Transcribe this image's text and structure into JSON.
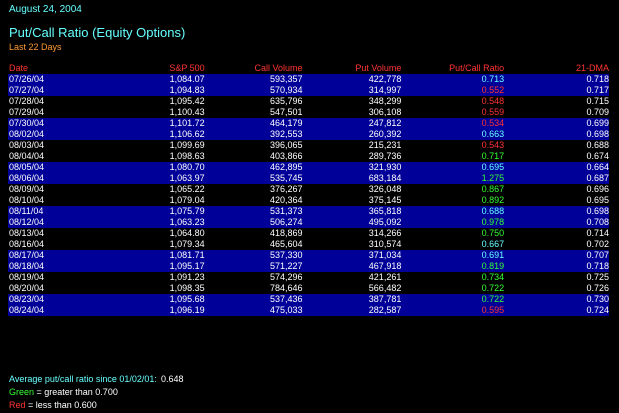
{
  "header": {
    "date": "August 24, 2004",
    "title": "Put/Call Ratio (Equity Options)",
    "subtitle": "Last 22 Days"
  },
  "colors": {
    "background": "#000000",
    "band": "#000099",
    "cyan": "#66ffff",
    "green": "#33ff33",
    "red": "#ff3333",
    "orange": "#ff9933"
  },
  "table": {
    "columns": [
      "Date",
      "S&P 500",
      "Call Volume",
      "Put Volume",
      "Put/Call Ratio",
      "21-DMA"
    ],
    "rows": [
      {
        "date": "07/26/04",
        "sp": "1,084.07",
        "call": "593,357",
        "put": "422,778",
        "ratio": "0.713",
        "dma": "0.718",
        "ratio_color": "cyan",
        "band": true
      },
      {
        "date": "07/27/04",
        "sp": "1,094.83",
        "call": "570,934",
        "put": "314,997",
        "ratio": "0.552",
        "dma": "0.717",
        "ratio_color": "red",
        "band": true
      },
      {
        "date": "07/28/04",
        "sp": "1,095.42",
        "call": "635,796",
        "put": "348,299",
        "ratio": "0.548",
        "dma": "0.715",
        "ratio_color": "red",
        "band": false
      },
      {
        "date": "07/29/04",
        "sp": "1,100.43",
        "call": "547,501",
        "put": "306,108",
        "ratio": "0.559",
        "dma": "0.709",
        "ratio_color": "red",
        "band": false
      },
      {
        "date": "07/30/04",
        "sp": "1,101.72",
        "call": "464,179",
        "put": "247,812",
        "ratio": "0.534",
        "dma": "0.699",
        "ratio_color": "red",
        "band": true
      },
      {
        "date": "08/02/04",
        "sp": "1,106.62",
        "call": "392,553",
        "put": "260,392",
        "ratio": "0.663",
        "dma": "0.698",
        "ratio_color": "cyan",
        "band": true
      },
      {
        "date": "08/03/04",
        "sp": "1,099.69",
        "call": "396,065",
        "put": "215,231",
        "ratio": "0.543",
        "dma": "0.688",
        "ratio_color": "red",
        "band": false
      },
      {
        "date": "08/04/04",
        "sp": "1,098.63",
        "call": "403,866",
        "put": "289,736",
        "ratio": "0.717",
        "dma": "0.674",
        "ratio_color": "green",
        "band": false
      },
      {
        "date": "08/05/04",
        "sp": "1,080.70",
        "call": "462,895",
        "put": "321,930",
        "ratio": "0.695",
        "dma": "0.664",
        "ratio_color": "cyan",
        "band": true
      },
      {
        "date": "08/06/04",
        "sp": "1,063.97",
        "call": "535,745",
        "put": "683,184",
        "ratio": "1.275",
        "dma": "0.687",
        "ratio_color": "green",
        "band": true
      },
      {
        "date": "08/09/04",
        "sp": "1,065.22",
        "call": "376,267",
        "put": "326,048",
        "ratio": "0.867",
        "dma": "0.696",
        "ratio_color": "green",
        "band": false
      },
      {
        "date": "08/10/04",
        "sp": "1,079.04",
        "call": "420,364",
        "put": "375,145",
        "ratio": "0.892",
        "dma": "0.695",
        "ratio_color": "green",
        "band": false
      },
      {
        "date": "08/11/04",
        "sp": "1,075.79",
        "call": "531,373",
        "put": "365,818",
        "ratio": "0.688",
        "dma": "0.698",
        "ratio_color": "cyan",
        "band": true
      },
      {
        "date": "08/12/04",
        "sp": "1,063.23",
        "call": "506,274",
        "put": "495,092",
        "ratio": "0.978",
        "dma": "0.708",
        "ratio_color": "green",
        "band": true
      },
      {
        "date": "08/13/04",
        "sp": "1,064.80",
        "call": "418,869",
        "put": "314,266",
        "ratio": "0.750",
        "dma": "0.714",
        "ratio_color": "green",
        "band": false
      },
      {
        "date": "08/16/04",
        "sp": "1,079.34",
        "call": "465,604",
        "put": "310,574",
        "ratio": "0.667",
        "dma": "0.702",
        "ratio_color": "cyan",
        "band": false
      },
      {
        "date": "08/17/04",
        "sp": "1,081.71",
        "call": "537,330",
        "put": "371,034",
        "ratio": "0.691",
        "dma": "0.707",
        "ratio_color": "cyan",
        "band": true
      },
      {
        "date": "08/18/04",
        "sp": "1,095.17",
        "call": "571,227",
        "put": "467,918",
        "ratio": "0.819",
        "dma": "0.718",
        "ratio_color": "green",
        "band": true
      },
      {
        "date": "08/19/04",
        "sp": "1,091.23",
        "call": "574,296",
        "put": "421,261",
        "ratio": "0.734",
        "dma": "0.725",
        "ratio_color": "green",
        "band": false
      },
      {
        "date": "08/20/04",
        "sp": "1,098.35",
        "call": "784,646",
        "put": "566,482",
        "ratio": "0.722",
        "dma": "0.726",
        "ratio_color": "green",
        "band": false
      },
      {
        "date": "08/23/04",
        "sp": "1,095.68",
        "call": "537,436",
        "put": "387,781",
        "ratio": "0.722",
        "dma": "0.730",
        "ratio_color": "green",
        "band": true
      },
      {
        "date": "08/24/04",
        "sp": "1,096.19",
        "call": "475,033",
        "put": "282,587",
        "ratio": "0.595",
        "dma": "0.724",
        "ratio_color": "red",
        "band": true
      }
    ]
  },
  "footer": {
    "average_label": "Average put/call ratio since 01/02/01:",
    "average_value": "0.648",
    "green_key": "Green",
    "green_text": " = greater than 0.700",
    "red_key": "Red",
    "red_text": " = less than 0.600"
  }
}
